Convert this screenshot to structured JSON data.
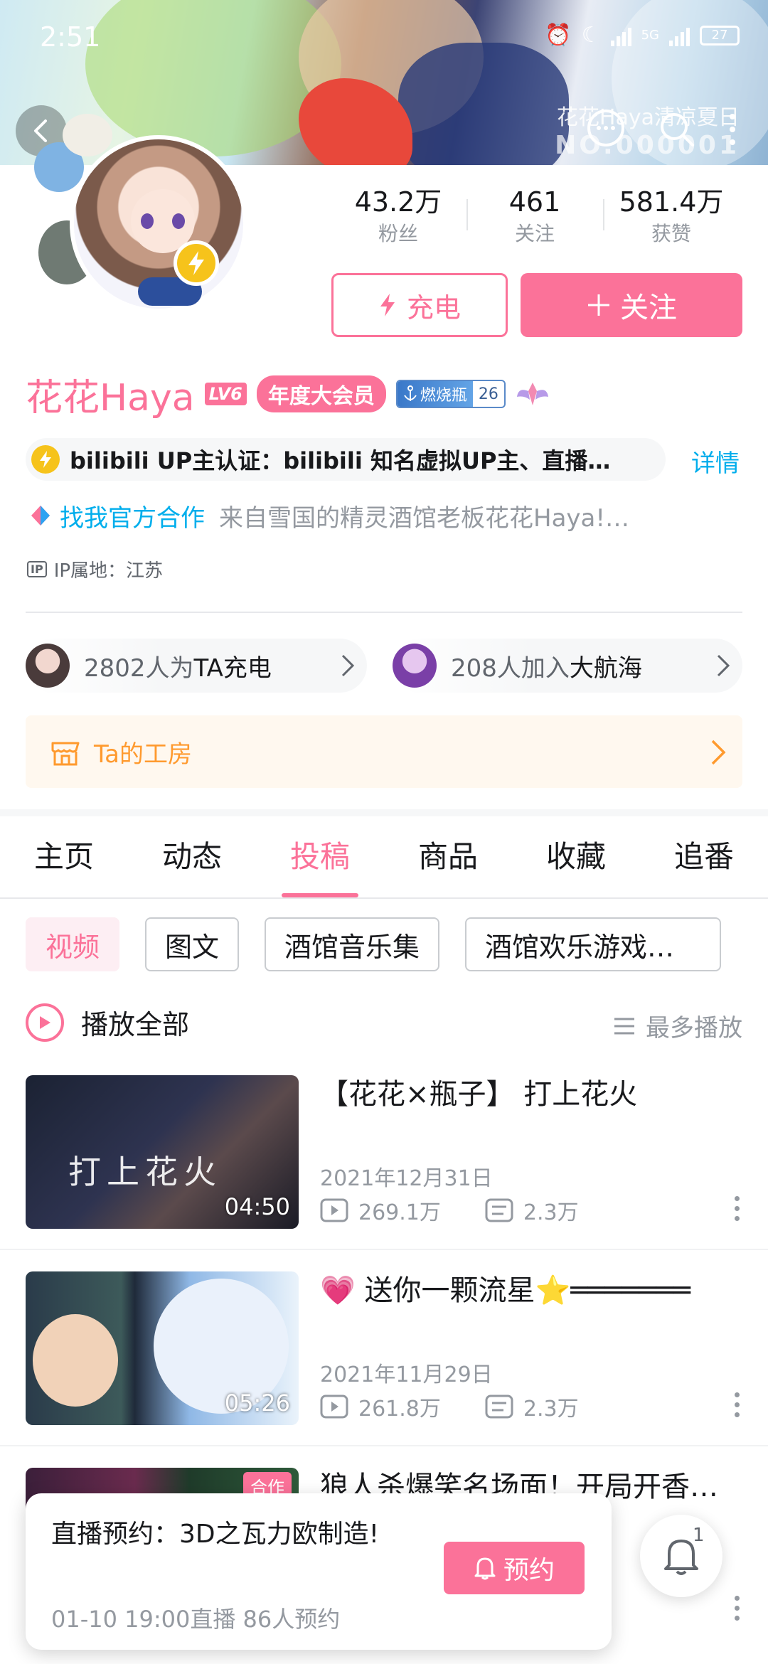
{
  "status_bar": {
    "time": "2:51",
    "network": "5G",
    "battery": "27"
  },
  "banner": {
    "caption": "花花Haya清凉夏日",
    "serial": "NO.000001"
  },
  "stats": [
    {
      "value": "43.2万",
      "label": "粉丝"
    },
    {
      "value": "461",
      "label": "关注"
    },
    {
      "value": "581.4万",
      "label": "获赞"
    }
  ],
  "actions": {
    "charge_label": "充电",
    "follow_label": "关注"
  },
  "profile": {
    "name": "花花Haya",
    "level": "LV6",
    "vip_label": "年度大会员",
    "medal_name": "燃烧瓶",
    "medal_level": "26",
    "certification": "bilibili UP主认证：bilibili 知名虚拟UP主、直播…",
    "detail_link": "详情",
    "cooperation_link": "找我官方合作",
    "sign": "来自雪国的精灵酒馆老板花花Haya!…",
    "ip_tag": "IP",
    "ip_location": "IP属地：江苏"
  },
  "supporters": {
    "charge_count": "2802人为TA充电",
    "charge_prefix": "2802人为",
    "charge_suffix": "TA充电",
    "guard_prefix": "208人加入",
    "guard_suffix": "大航海"
  },
  "workshop": {
    "label": "Ta的工房"
  },
  "tabs": [
    {
      "label": "主页"
    },
    {
      "label": "动态"
    },
    {
      "label": "投稿"
    },
    {
      "label": "商品"
    },
    {
      "label": "收藏"
    },
    {
      "label": "追番"
    }
  ],
  "active_tab": "投稿",
  "filters": [
    {
      "label": "视频"
    },
    {
      "label": "图文"
    },
    {
      "label": "酒馆音乐集"
    },
    {
      "label": "酒馆欢乐游戏…"
    }
  ],
  "list_header": {
    "play_all": "播放全部",
    "sort": "最多播放"
  },
  "videos": [
    {
      "title": "【花花×瓶子】 打上花火",
      "duration": "04:50",
      "date": "2021年12月31日",
      "plays": "269.1万",
      "danmaku": "2.3万"
    },
    {
      "title": "💗 送你一颗流星⭐═══════",
      "duration": "05:26",
      "date": "2021年11月29日",
      "plays": "261.8万",
      "danmaku": "2.3万"
    },
    {
      "title": "狼人杀爆笑名场面！开局开香…的表演…",
      "badge": "合作"
    }
  ],
  "reservation": {
    "title": "直播预约：3D之瓦力欧制造!",
    "subtitle": "01-10 19:00直播 86人预约",
    "button": "预约"
  },
  "notification_count": "1",
  "colors": {
    "accent": "#fb7299",
    "link": "#00aeec",
    "workshop": "#ff9a2e",
    "gold": "#f6c31b"
  }
}
